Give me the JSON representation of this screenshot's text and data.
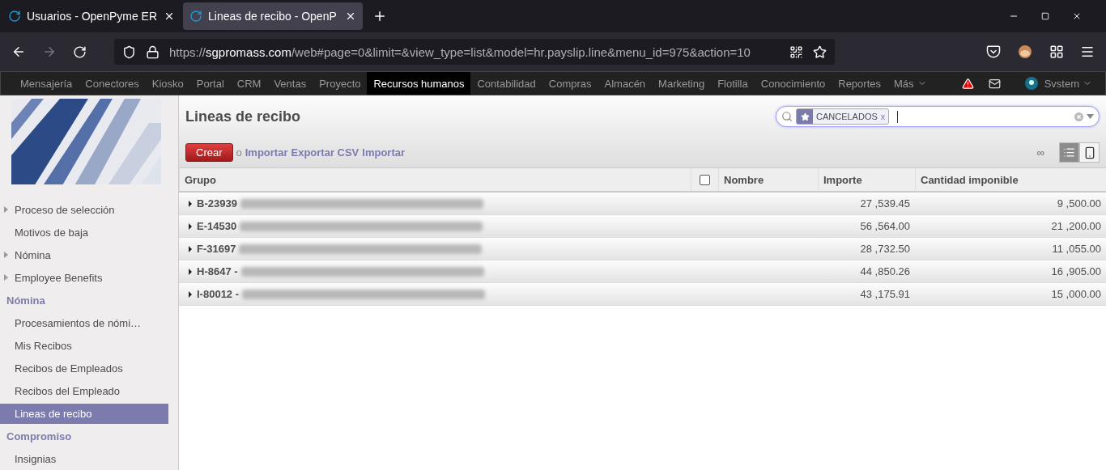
{
  "browser": {
    "tabs": [
      {
        "title": "Usuarios - OpenPyme ER",
        "selected": false
      },
      {
        "title": "Lineas de recibo - OpenP",
        "selected": true
      }
    ],
    "url": {
      "scheme": "https://",
      "host": "sgpromass.com",
      "path": "/web#page=0&limit=&view_type=list&model=hr.payslip.line&menu_id=975&action=10"
    }
  },
  "app_menu": {
    "items": [
      {
        "label": "Mensajería",
        "selected": false
      },
      {
        "label": "Conectores",
        "selected": false
      },
      {
        "label": "Kiosko",
        "selected": false
      },
      {
        "label": "Portal",
        "selected": false
      },
      {
        "label": "CRM",
        "selected": false
      },
      {
        "label": "Ventas",
        "selected": false
      },
      {
        "label": "Proyecto",
        "selected": false
      },
      {
        "label": "Recursos humanos",
        "selected": true
      },
      {
        "label": "Contabilidad",
        "selected": false
      },
      {
        "label": "Compras",
        "selected": false
      },
      {
        "label": "Almacén",
        "selected": false
      },
      {
        "label": "Marketing",
        "selected": false
      },
      {
        "label": "Flotilla",
        "selected": false
      },
      {
        "label": "Conocimiento",
        "selected": false
      },
      {
        "label": "Reportes",
        "selected": false
      }
    ],
    "more": "Más",
    "user": "Svstem"
  },
  "sidebar": {
    "sections": [
      {
        "items": [
          {
            "label": "Proceso de selección",
            "expandable": true,
            "selected": false
          },
          {
            "label": "Motivos de baja",
            "expandable": false,
            "selected": false
          },
          {
            "label": "Nómina",
            "expandable": true,
            "selected": false
          },
          {
            "label": "Employee Benefits",
            "expandable": true,
            "selected": false
          }
        ]
      },
      {
        "header": "Nómina",
        "items": [
          {
            "label": "Procesamientos de nómi…",
            "expandable": false,
            "selected": false
          },
          {
            "label": "Mis Recibos",
            "expandable": false,
            "selected": false
          },
          {
            "label": "Recibos de Empleados",
            "expandable": false,
            "selected": false
          },
          {
            "label": "Recibos del Empleado",
            "expandable": false,
            "selected": false
          },
          {
            "label": "Lineas de recibo",
            "expandable": false,
            "selected": true
          }
        ]
      },
      {
        "header": "Compromiso",
        "items": [
          {
            "label": "Insignias",
            "expandable": false,
            "selected": false
          }
        ]
      }
    ]
  },
  "page": {
    "title": "Lineas de recibo",
    "create_button": "Crear",
    "separator": "o",
    "links": [
      "Importar",
      "Exportar CSV",
      "Importar"
    ],
    "search": {
      "facets": [
        {
          "label": "CANCELADOS",
          "remove": "x"
        }
      ]
    },
    "pager": "∞",
    "views": [
      {
        "kind": "list",
        "selected": true
      },
      {
        "kind": "form",
        "selected": false
      }
    ]
  },
  "table": {
    "columns": [
      {
        "kind": "text",
        "label": "Grupo"
      },
      {
        "kind": "checkbox",
        "checked": false
      },
      {
        "kind": "text",
        "label": "Nombre"
      },
      {
        "kind": "text",
        "label": "Importe"
      },
      {
        "kind": "text",
        "label": "Cantidad imponible"
      }
    ],
    "rows": [
      {
        "group": "B-23939",
        "expanded": false,
        "importe": "27 ,539.45",
        "cantidad": "9 ,500.00"
      },
      {
        "group": "E-14530",
        "expanded": false,
        "importe": "56 ,564.00",
        "cantidad": "21 ,200.00"
      },
      {
        "group": "F-31697",
        "expanded": false,
        "importe": "28 ,732.50",
        "cantidad": "11 ,055.00"
      },
      {
        "group": "H-8647 -",
        "expanded": false,
        "importe": "44 ,850.26",
        "cantidad": "16 ,905.00"
      },
      {
        "group": "I-80012 -",
        "expanded": false,
        "importe": "43 ,175.91",
        "cantidad": "15 ,000.00"
      }
    ]
  }
}
